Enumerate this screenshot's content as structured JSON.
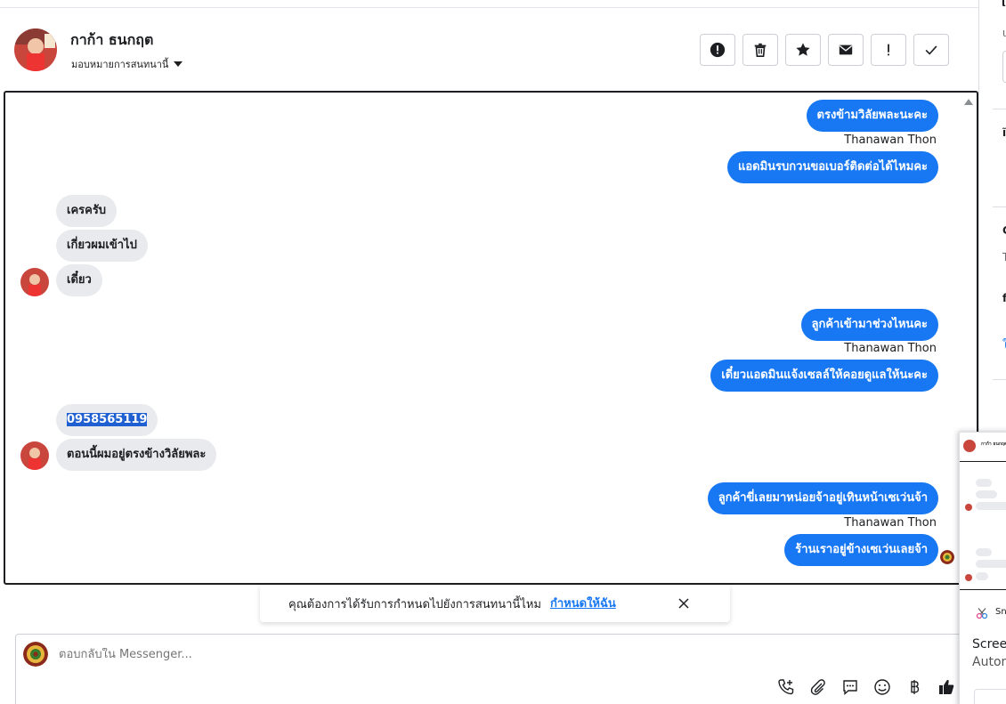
{
  "header": {
    "contact_name": "กาก้า ธนกฤต",
    "assign_label": "มอบหมายการสนทนานี้",
    "actions": [
      {
        "icon": "alert-circle-icon",
        "name": "mark-spam-button"
      },
      {
        "icon": "trash-icon",
        "name": "delete-button"
      },
      {
        "icon": "star-icon",
        "name": "star-button"
      },
      {
        "icon": "envelope-icon",
        "name": "mark-unread-button"
      },
      {
        "icon": "exclamation-icon",
        "name": "follow-up-button"
      },
      {
        "icon": "check-icon",
        "name": "mark-done-button"
      }
    ]
  },
  "messages": [
    {
      "id": "m1",
      "dir": "out",
      "text": "ตรงข้ามวิลัยพละนะคะ"
    },
    {
      "id": "s1",
      "sender": "Thanawan Thon"
    },
    {
      "id": "m2",
      "dir": "out",
      "text": "แอดมินรบกวนขอเบอร์ติดต่อได้ไหมคะ"
    },
    {
      "id": "m3",
      "dir": "in",
      "text": "เครครับ"
    },
    {
      "id": "m4",
      "dir": "in",
      "text": "เกี่ยวผมเข้าไป"
    },
    {
      "id": "m5",
      "dir": "in",
      "text": "เดี๋ยว"
    },
    {
      "id": "m6",
      "dir": "out",
      "text": "ลูกค้าเข้ามาช่วงไหนคะ"
    },
    {
      "id": "s2",
      "sender": "Thanawan Thon"
    },
    {
      "id": "m7",
      "dir": "out",
      "text": "เดี๋ยวแอดมินแจ้งเซลล์ให้คอยดูแลให้นะคะ"
    },
    {
      "id": "m8",
      "dir": "in",
      "text": "0958565119"
    },
    {
      "id": "m9",
      "dir": "in",
      "text": "ตอนนี้ผมอยู่ตรงข้างวิลัยพละ"
    },
    {
      "id": "m10",
      "dir": "out",
      "text": "ลูกค้าขี่เลยมาหน่อยจ้าอยู่เทินหน้าเซเว่นจ้า"
    },
    {
      "id": "s3",
      "sender": "Thanawan Thon"
    },
    {
      "id": "m11",
      "dir": "out",
      "text": "ร้านเราอยู่ข้างเซเว่นเลยจ้า"
    }
  ],
  "banner": {
    "text": "คุณต้องการได้รับการกำหนดไปยังการสนทนานี้ไหม",
    "link": "กำหนดให้ฉัน"
  },
  "composer": {
    "placeholder": "ตอบกลับใน Messenger..."
  },
  "thumbnail": {
    "app_name": "Sn",
    "line1": "Screen",
    "line2": "Autom"
  },
  "colors": {
    "outgoing_bubble": "#1877f2",
    "incoming_bubble": "#e9eaee",
    "link": "#1877f2"
  }
}
